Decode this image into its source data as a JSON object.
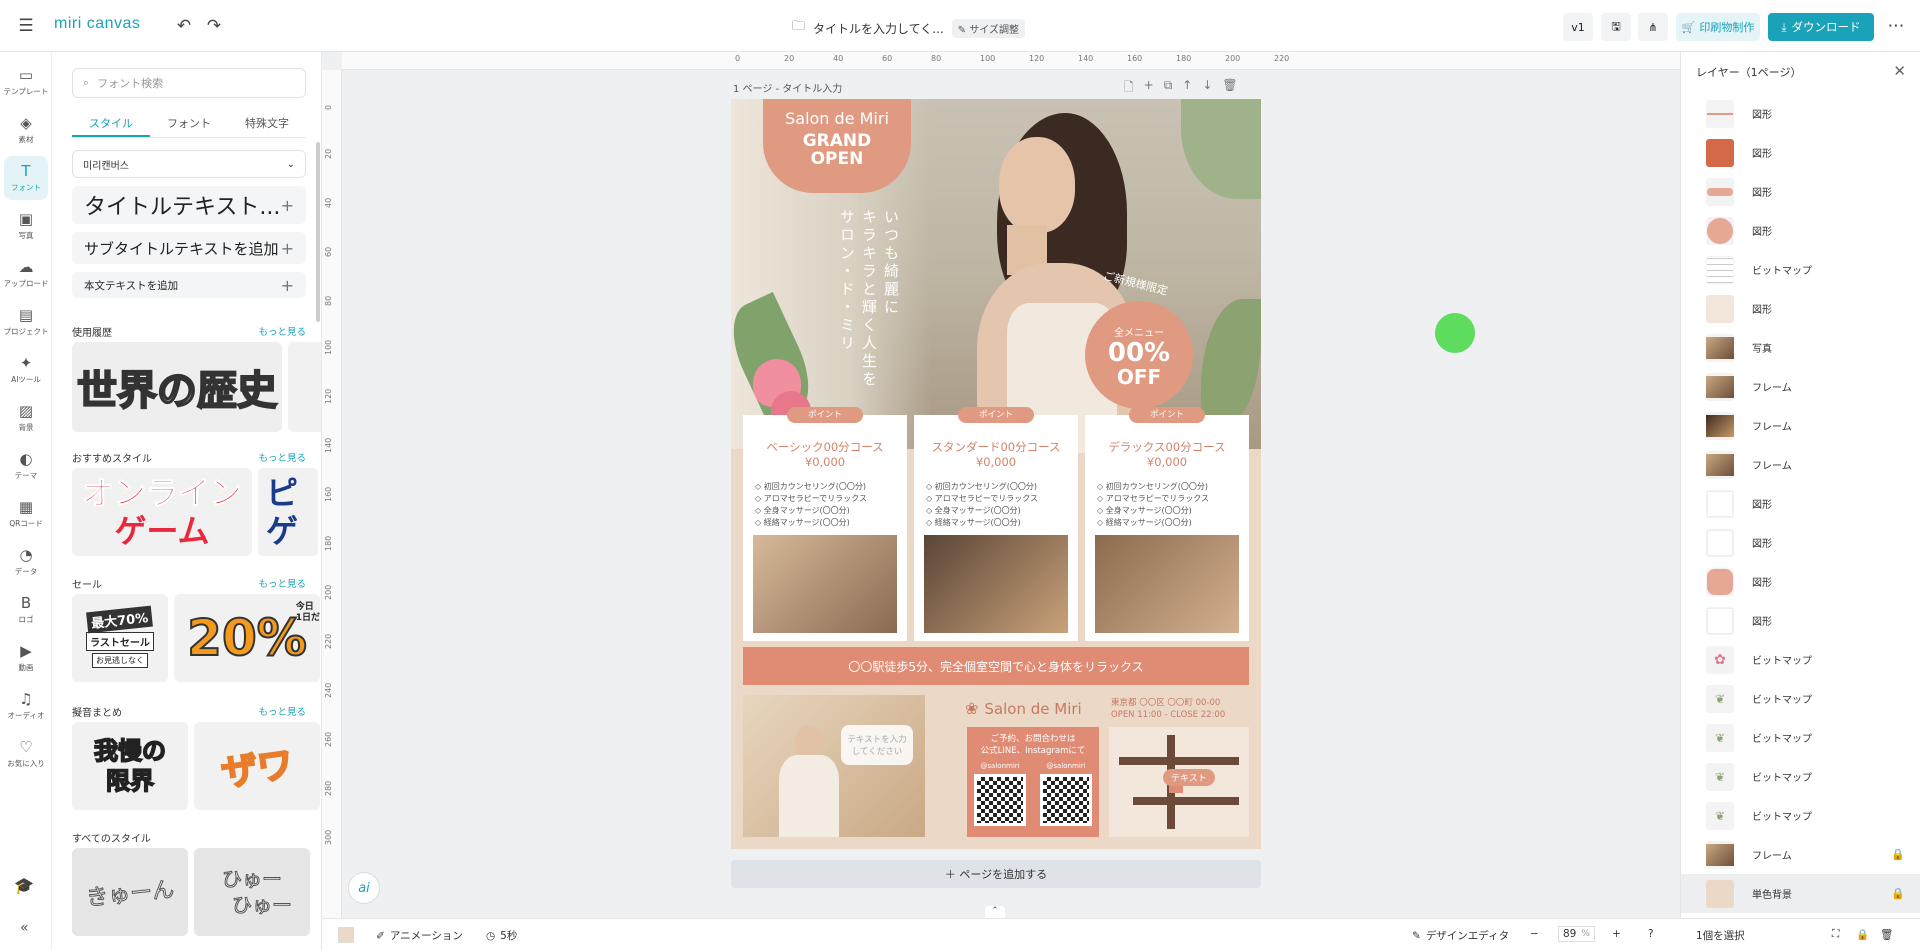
{
  "app": {
    "logo": "miri canvas"
  },
  "header": {
    "doc_title": "タイトルを入力してく...",
    "resize_pill": "サイズ調整",
    "version": "v1",
    "print_label": "印刷物制作",
    "download_label": "ダウンロード"
  },
  "leftnav": [
    {
      "id": "template",
      "label": "テンプレート",
      "icon": "▭"
    },
    {
      "id": "element",
      "label": "素材",
      "icon": "◈"
    },
    {
      "id": "font",
      "label": "フォント",
      "icon": "T"
    },
    {
      "id": "photo",
      "label": "写真",
      "icon": "▣"
    },
    {
      "id": "upload",
      "label": "アップロード",
      "icon": "☁"
    },
    {
      "id": "project",
      "label": "プロジェクト",
      "icon": "▤"
    },
    {
      "id": "ai",
      "label": "AIツール",
      "icon": "✦"
    },
    {
      "id": "background",
      "label": "背景",
      "icon": "▨"
    },
    {
      "id": "theme",
      "label": "テーマ",
      "icon": "◐"
    },
    {
      "id": "qr",
      "label": "QRコード",
      "icon": "▦"
    },
    {
      "id": "data",
      "label": "データ",
      "icon": "◔"
    },
    {
      "id": "logo",
      "label": "ロゴ",
      "icon": "B"
    },
    {
      "id": "video",
      "label": "動画",
      "icon": "▶"
    },
    {
      "id": "audio",
      "label": "オーディオ",
      "icon": "♫"
    },
    {
      "id": "favorite",
      "label": "お気に入り",
      "icon": "♡"
    }
  ],
  "panel": {
    "search_placeholder": "フォント検索",
    "tabs": [
      "スタイル",
      "フォント",
      "特殊文字"
    ],
    "font_select": "미리캔버스",
    "add_title": "タイトルテキスト...",
    "add_subtitle": "サブタイトルテキストを追加",
    "add_body": "本文テキストを追加",
    "more": "もっと見る",
    "sec_history": "使用履歴",
    "sec_recommend": "おすすめスタイル",
    "sec_sale": "セール",
    "sec_onomatopoeia": "擬音まとめ",
    "sec_all": "すべてのスタイル",
    "thumb_history": "世界の歴史",
    "thumb_recommend_1": "オンライン",
    "thumb_recommend_2": "ゲーム",
    "thumb_recommend_3a": "ピ",
    "thumb_recommend_3b": "ゲ",
    "thumb_sale_1": "最大70%",
    "thumb_sale_2": "ラストセール",
    "thumb_sale_3": "お見逃しなく",
    "thumb_sale_4": "20%",
    "thumb_sale_5": "今日",
    "thumb_sale_6": "1日だ",
    "thumb_ono_1": "我慢の",
    "thumb_ono_2": "限界",
    "thumb_ono_3": "ザワ",
    "thumb_all_1": "きゅーん",
    "thumb_all_2": "ひゅー",
    "thumb_all_3": "ひゅー"
  },
  "canvas": {
    "page_label": "1 ページ - タイトル入力",
    "add_page": "ページを追加する",
    "ruler_h": [
      "0",
      "20",
      "40",
      "60",
      "80",
      "100",
      "120",
      "140",
      "160",
      "180",
      "200",
      "220"
    ],
    "ruler_v": [
      "0",
      "20",
      "40",
      "60",
      "80",
      "100",
      "120",
      "140",
      "160",
      "180",
      "200",
      "220",
      "240",
      "260",
      "280",
      "300"
    ]
  },
  "poster": {
    "salon": "Salon de Miri",
    "grand": "GRAND",
    "open": "OPEN",
    "vertical_1": "いつも綺麗に",
    "vertical_2": "キラキラと輝く人生を",
    "vertical_3": "サロン・ド・ミリ",
    "badge_top": "ご新規様限定",
    "badge_menu": "全メニュー",
    "badge_value": "00%",
    "badge_off": "OFF",
    "point": "ポイント",
    "courses": [
      {
        "name": "ベーシック00分コース",
        "price": "¥0,000"
      },
      {
        "name": "スタンダード00分コース",
        "price": "¥0,000"
      },
      {
        "name": "デラックス00分コース",
        "price": "¥0,000"
      }
    ],
    "bullets": [
      "◇ 初回カウンセリング(〇〇分)",
      "◇ アロマセラピーでリラックス",
      "◇ 全身マッサージ(〇〇分)",
      "◇ 経絡マッサージ(〇〇分)"
    ],
    "banner": "〇〇駅徒歩5分、完全個室空間で心と身体をリラックス",
    "bubble": "テキストを入力してください",
    "footer_salon": "Salon de Miri",
    "address": "東京都 〇〇区 〇〇町 00-00",
    "hours": "OPEN 11:00 - CLOSE 22:00",
    "reserve_1": "ご予約、お問合わせは",
    "reserve_2": "公式LINE、Instagramにて",
    "handle": "@salonmiri",
    "map_text": "テキスト"
  },
  "layers": {
    "title": "レイヤー（1ページ）",
    "items": [
      {
        "label": "図形",
        "thumb": "line"
      },
      {
        "label": "図形",
        "thumb": "square-dark"
      },
      {
        "label": "図形",
        "thumb": "pill"
      },
      {
        "label": "図形",
        "thumb": "circle"
      },
      {
        "label": "ビットマップ",
        "thumb": "grid"
      },
      {
        "label": "図形",
        "thumb": "beige"
      },
      {
        "label": "写真",
        "thumb": "photo"
      },
      {
        "label": "フレーム",
        "thumb": "photo"
      },
      {
        "label": "フレーム",
        "thumb": "photo-dark"
      },
      {
        "label": "フレーム",
        "thumb": "photo"
      },
      {
        "label": "図形",
        "thumb": "white"
      },
      {
        "label": "図形",
        "thumb": "white"
      },
      {
        "label": "図形",
        "thumb": "hexagon"
      },
      {
        "label": "図形",
        "thumb": "white"
      },
      {
        "label": "ビットマップ",
        "thumb": "flower"
      },
      {
        "label": "ビットマップ",
        "thumb": "leaf"
      },
      {
        "label": "ビットマップ",
        "thumb": "leaf"
      },
      {
        "label": "ビットマップ",
        "thumb": "leaf"
      },
      {
        "label": "ビットマップ",
        "thumb": "leaf"
      },
      {
        "label": "フレーム",
        "thumb": "photo",
        "locked": true
      },
      {
        "label": "単色背景",
        "thumb": "bg",
        "locked": true,
        "selected": true
      }
    ],
    "select_one": "1個を選択"
  },
  "bottom": {
    "animation": "アニメーション",
    "duration": "5秒",
    "design_editor": "デザインエディタ",
    "zoom": "89",
    "zoom_unit": "%"
  },
  "colors": {
    "accent": "#1aa3b8",
    "salmon": "#e09a82",
    "poster_bg": "#ecd8c6",
    "banner": "#e08b73"
  }
}
